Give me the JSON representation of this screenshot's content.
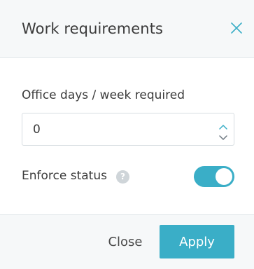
{
  "dialog": {
    "title": "Work requirements"
  },
  "office_days": {
    "label": "Office days / week required",
    "value": "0"
  },
  "enforce_status": {
    "label": "Enforce status",
    "help_glyph": "?",
    "enabled": true
  },
  "footer": {
    "close_label": "Close",
    "apply_label": "Apply"
  },
  "colors": {
    "accent": "#3aaec7",
    "header_bg": "#f6f8f9",
    "text": "#3b3b3b"
  },
  "icons": {
    "close": "close-icon",
    "increment": "chevron-up-icon",
    "decrement": "chevron-down-icon",
    "help": "question-mark-icon"
  }
}
